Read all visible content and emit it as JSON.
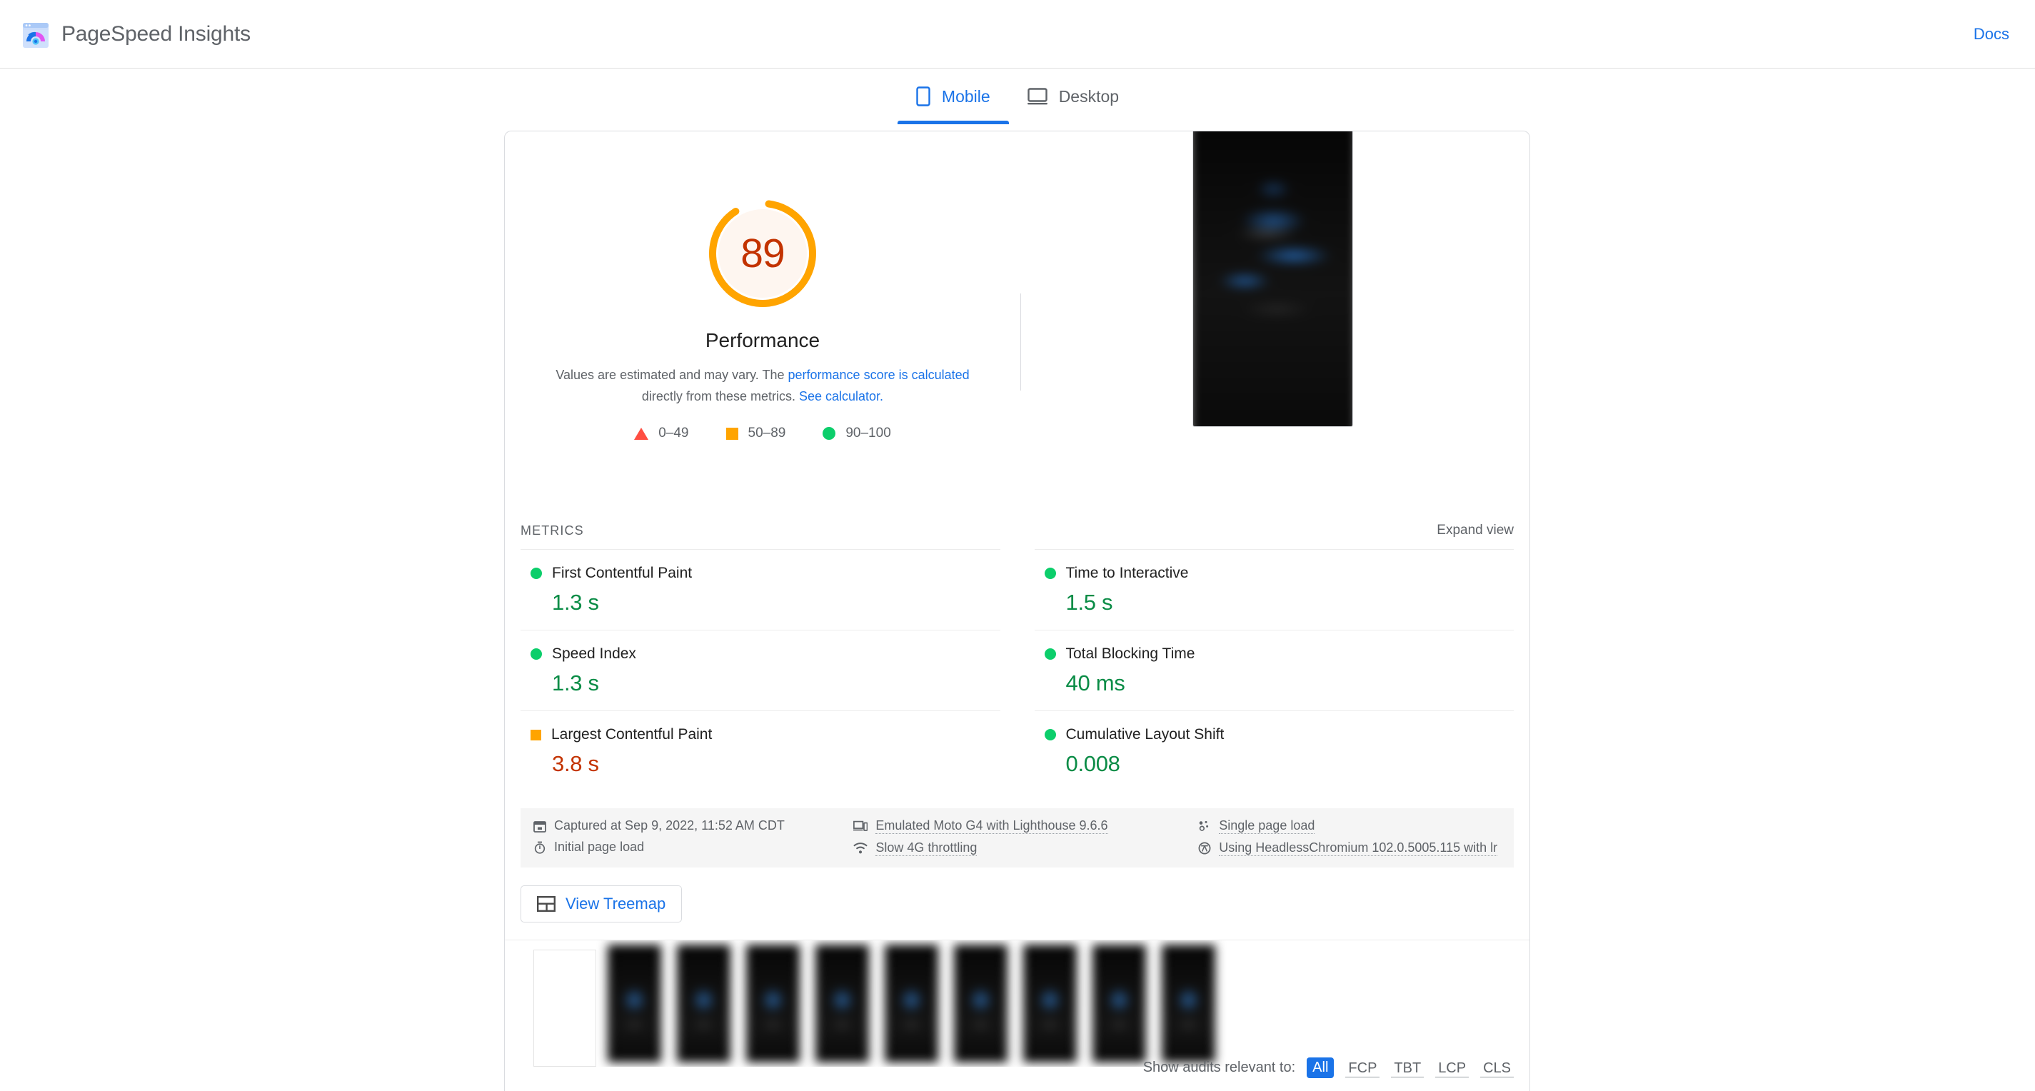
{
  "header": {
    "title": "PageSpeed Insights",
    "logo_icon": "pagespeed-logo-icon",
    "docs_label": "Docs"
  },
  "tabs": [
    {
      "label": "Mobile",
      "icon": "mobile-phone-icon",
      "active": true
    },
    {
      "label": "Desktop",
      "icon": "desktop-monitor-icon",
      "active": false
    }
  ],
  "score": {
    "value": "89",
    "category": "Performance",
    "gauge_color": "#ffa400",
    "gauge_fill": "#fef6f0",
    "number_color": "#c33300",
    "gauge_percent": 89,
    "description_prefix": "Values are estimated and may vary. The ",
    "description_link1": "performance score is calculated",
    "description_middle": " directly from these metrics. ",
    "description_link2": "See calculator.",
    "legend": [
      {
        "shape": "triangle",
        "color": "#ff4e42",
        "range": "0–49"
      },
      {
        "shape": "square",
        "color": "#ffa400",
        "range": "50–89"
      },
      {
        "shape": "circle",
        "color": "#0cce6b",
        "range": "90–100"
      }
    ]
  },
  "screenshot": {
    "alt": "final-page-screenshot"
  },
  "metrics_section": {
    "label": "METRICS",
    "expand_label": "Expand view",
    "left": [
      {
        "name": "First Contentful Paint",
        "value": "1.3 s",
        "status": "green"
      },
      {
        "name": "Speed Index",
        "value": "1.3 s",
        "status": "green"
      },
      {
        "name": "Largest Contentful Paint",
        "value": "3.8 s",
        "status": "orange"
      }
    ],
    "right": [
      {
        "name": "Time to Interactive",
        "value": "1.5 s",
        "status": "green"
      },
      {
        "name": "Total Blocking Time",
        "value": "40 ms",
        "status": "green"
      },
      {
        "name": "Cumulative Layout Shift",
        "value": "0.008",
        "status": "green"
      }
    ]
  },
  "environment": {
    "col1": [
      {
        "icon": "calendar-icon",
        "text": "Captured at Sep 9, 2022, 11:52 AM CDT",
        "dotted": false
      },
      {
        "icon": "stopwatch-icon",
        "text": "Initial page load",
        "dotted": false
      }
    ],
    "col2": [
      {
        "icon": "devices-icon",
        "text": "Emulated Moto G4 with Lighthouse 9.6.6",
        "dotted": true
      },
      {
        "icon": "network-icon",
        "text": "Slow 4G throttling",
        "dotted": true
      }
    ],
    "col3": [
      {
        "icon": "single-page-icon",
        "text": "Single page load",
        "dotted": true
      },
      {
        "icon": "chromium-icon",
        "text": "Using HeadlessChromium 102.0.5005.115 with lr",
        "dotted": true
      }
    ]
  },
  "treemap": {
    "label": "View Treemap",
    "icon": "treemap-icon"
  },
  "filmstrip": {
    "frame_count": 9,
    "blank_leading_frame": true
  },
  "audit_filter": {
    "label": "Show audits relevant to:",
    "chips": [
      {
        "label": "All",
        "active": true
      },
      {
        "label": "FCP",
        "active": false
      },
      {
        "label": "TBT",
        "active": false
      },
      {
        "label": "LCP",
        "active": false
      },
      {
        "label": "CLS",
        "active": false
      }
    ]
  }
}
